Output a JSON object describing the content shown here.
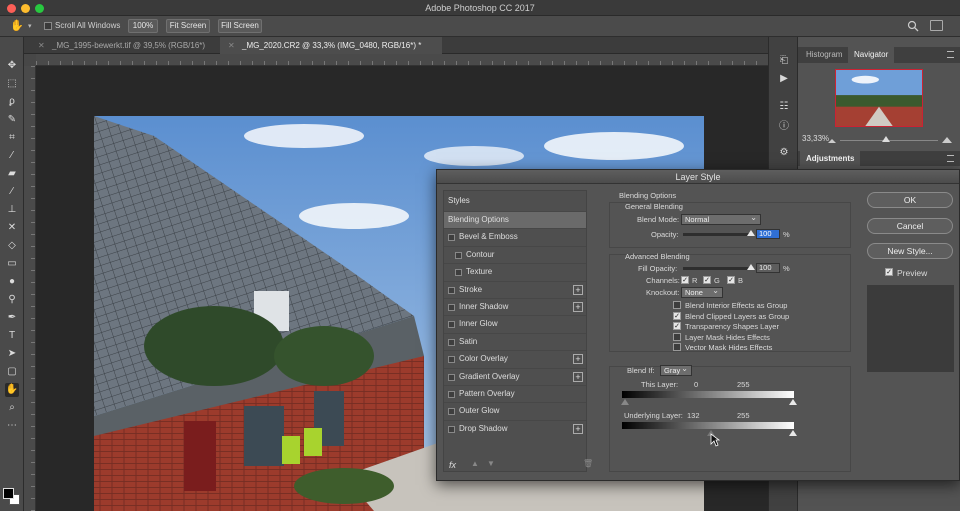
{
  "app": {
    "title": "Adobe Photoshop CC 2017"
  },
  "options_bar": {
    "scroll_all_windows": "Scroll All Windows",
    "zoom_button": "100%",
    "fit_screen_button": "Fit Screen",
    "fill_screen_button": "Fill Screen"
  },
  "document_tabs": [
    {
      "label": "_MG_1995-bewerkt.tif @ 39,5% (RGB/16*)",
      "active": false
    },
    {
      "label": "_MG_2020.CR2 @ 33,3% (IMG_0480, RGB/16*) *",
      "active": true
    }
  ],
  "right_panel": {
    "tabs": [
      "Histogram",
      "Navigator"
    ],
    "active_tab": "Navigator",
    "zoom": "33,33%",
    "adjustments_title": "Adjustments"
  },
  "layer_style": {
    "title": "Layer Style",
    "styles_header": "Styles",
    "styles": [
      {
        "label": "Blending Options",
        "selected": true,
        "checkbox": false,
        "plus": false,
        "indent": false
      },
      {
        "label": "Bevel & Emboss",
        "selected": false,
        "checkbox": true,
        "plus": false,
        "indent": false
      },
      {
        "label": "Contour",
        "selected": false,
        "checkbox": true,
        "plus": false,
        "indent": true
      },
      {
        "label": "Texture",
        "selected": false,
        "checkbox": true,
        "plus": false,
        "indent": true
      },
      {
        "label": "Stroke",
        "selected": false,
        "checkbox": true,
        "plus": true,
        "indent": false
      },
      {
        "label": "Inner Shadow",
        "selected": false,
        "checkbox": true,
        "plus": true,
        "indent": false
      },
      {
        "label": "Inner Glow",
        "selected": false,
        "checkbox": true,
        "plus": false,
        "indent": false
      },
      {
        "label": "Satin",
        "selected": false,
        "checkbox": true,
        "plus": false,
        "indent": false
      },
      {
        "label": "Color Overlay",
        "selected": false,
        "checkbox": true,
        "plus": true,
        "indent": false
      },
      {
        "label": "Gradient Overlay",
        "selected": false,
        "checkbox": true,
        "plus": true,
        "indent": false
      },
      {
        "label": "Pattern Overlay",
        "selected": false,
        "checkbox": true,
        "plus": false,
        "indent": false
      },
      {
        "label": "Outer Glow",
        "selected": false,
        "checkbox": true,
        "plus": false,
        "indent": false
      },
      {
        "label": "Drop Shadow",
        "selected": false,
        "checkbox": true,
        "plus": true,
        "indent": false
      }
    ],
    "fx_label": "fx",
    "blending_options_title": "Blending Options",
    "general_blending_title": "General Blending",
    "blend_mode_label": "Blend Mode:",
    "blend_mode_value": "Normal",
    "opacity_label": "Opacity:",
    "opacity_value": "100",
    "opacity_level": 1.0,
    "percent": "%",
    "advanced_blending_title": "Advanced Blending",
    "fill_opacity_label": "Fill Opacity:",
    "fill_opacity_value": "100",
    "fill_opacity_level": 1.0,
    "channels_label": "Channels:",
    "channel_r": "R",
    "channel_g": "G",
    "channel_b": "B",
    "knockout_label": "Knockout:",
    "knockout_value": "None",
    "advanced_options": [
      {
        "label": "Blend Interior Effects as Group",
        "checked": false
      },
      {
        "label": "Blend Clipped Layers as Group",
        "checked": true
      },
      {
        "label": "Transparency Shapes Layer",
        "checked": true
      },
      {
        "label": "Layer Mask Hides Effects",
        "checked": false
      },
      {
        "label": "Vector Mask Hides Effects",
        "checked": false
      }
    ],
    "blend_if_label": "Blend If:",
    "blend_if_value": "Gray",
    "this_layer_label": "This Layer:",
    "this_layer_low": "0",
    "this_layer_high": "255",
    "underlying_layer_label": "Underlying Layer:",
    "underlying_low": "132",
    "underlying_high": "255",
    "buttons": {
      "ok": "OK",
      "cancel": "Cancel",
      "new_style": "New Style..."
    },
    "preview_label": "Preview",
    "preview_checked": true
  }
}
